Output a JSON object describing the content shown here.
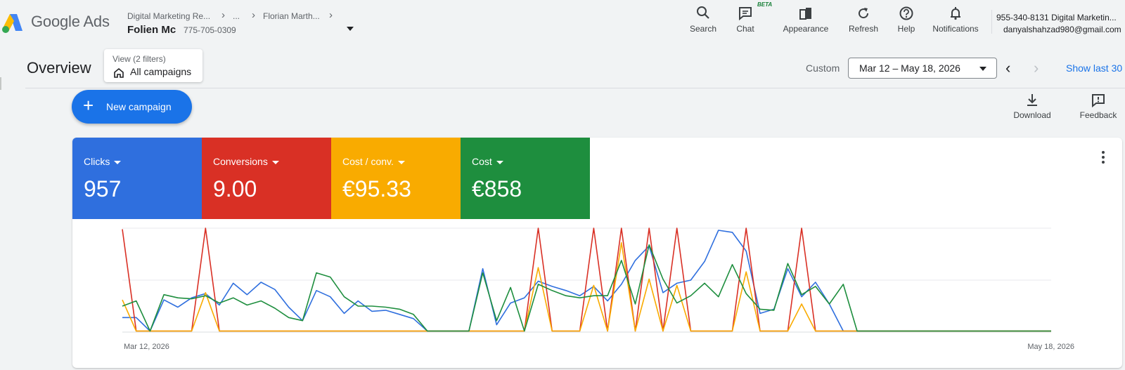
{
  "header": {
    "brand": "Google Ads",
    "breadcrumb": [
      "Digital Marketing Re...",
      "...",
      "Florian Marth..."
    ],
    "account_name": "Folien Mc",
    "account_id": "775-705-0309",
    "tools": [
      {
        "label": "Search",
        "icon": "search-icon"
      },
      {
        "label": "Chat",
        "icon": "chat-icon"
      },
      {
        "label": "Appearance",
        "icon": "appearance-icon"
      },
      {
        "label": "Refresh",
        "icon": "refresh-icon"
      },
      {
        "label": "Help",
        "icon": "help-icon"
      },
      {
        "label": "Notifications",
        "icon": "bell-icon"
      }
    ],
    "chat_badge": "BETA",
    "user_phone": "955-340-8131 Digital Marketin...",
    "user_email": "danyalshahzad980@gmail.com"
  },
  "overview": {
    "title": "Overview",
    "view_label": "View (2 filters)",
    "view_value": "All campaigns",
    "custom_label": "Custom",
    "date_range": "Mar 12 – May 18, 2026",
    "show_last": "Show last 30"
  },
  "actions": {
    "new_campaign": "New campaign",
    "download": "Download",
    "feedback": "Feedback"
  },
  "metrics": [
    {
      "name": "Clicks",
      "value": "957",
      "color": "#2f6fde"
    },
    {
      "name": "Conversions",
      "value": "9.00",
      "color": "#d93025"
    },
    {
      "name": "Cost / conv.",
      "value": "€95.33",
      "color": "#f9ab00"
    },
    {
      "name": "Cost",
      "value": "€858",
      "color": "#1e8e3e"
    }
  ],
  "chart_data": {
    "type": "line",
    "x_start_label": "Mar 12, 2026",
    "x_end_label": "May 18, 2026",
    "ylim": [
      0,
      1
    ],
    "grid": true,
    "series": [
      {
        "name": "Clicks",
        "color": "#2f6fde",
        "values": [
          0.14,
          0.14,
          0.01,
          0.31,
          0.24,
          0.33,
          0.37,
          0.26,
          0.47,
          0.36,
          0.48,
          0.41,
          0.24,
          0.11,
          0.4,
          0.34,
          0.18,
          0.3,
          0.2,
          0.21,
          0.17,
          0.13,
          0.01,
          0.01,
          0.01,
          0.01,
          0.61,
          0.07,
          0.28,
          0.33,
          0.49,
          0.44,
          0.4,
          0.35,
          0.44,
          0.3,
          0.46,
          0.69,
          0.83,
          0.38,
          0.47,
          0.5,
          0.68,
          0.98,
          0.96,
          0.78,
          0.18,
          0.22,
          0.61,
          0.34,
          0.48,
          0.27,
          0.01,
          0.01,
          0.01,
          0.01,
          0.01,
          0.01,
          0.01,
          0.01,
          0.01,
          0.01,
          0.01,
          0.01,
          0.01,
          0.01,
          0.01,
          0.01
        ]
      },
      {
        "name": "Conversions",
        "color": "#d93025",
        "values": [
          0.99,
          0.01,
          0.01,
          0.01,
          0.01,
          0.01,
          1.0,
          0.01,
          0.01,
          0.01,
          0.01,
          0.01,
          0.01,
          0.01,
          0.01,
          0.01,
          0.01,
          0.01,
          0.01,
          0.01,
          0.01,
          0.01,
          0.01,
          0.01,
          0.01,
          0.01,
          0.01,
          0.01,
          0.01,
          0.01,
          1.0,
          0.01,
          0.01,
          0.01,
          1.0,
          0.01,
          1.0,
          0.01,
          1.0,
          0.01,
          1.0,
          0.01,
          0.01,
          0.01,
          0.01,
          1.0,
          0.01,
          0.01,
          0.01,
          1.0,
          0.01,
          0.01,
          0.01,
          0.01,
          0.01,
          0.01,
          0.01,
          0.01,
          0.01,
          0.01,
          0.01,
          0.01,
          0.01,
          0.01,
          0.01,
          0.01,
          0.01,
          0.01
        ]
      },
      {
        "name": "Cost / conv.",
        "color": "#f9ab00",
        "values": [
          0.31,
          0.01,
          0.01,
          0.01,
          0.01,
          0.01,
          0.38,
          0.01,
          0.01,
          0.01,
          0.01,
          0.01,
          0.01,
          0.01,
          0.01,
          0.01,
          0.01,
          0.01,
          0.01,
          0.01,
          0.01,
          0.01,
          0.01,
          0.01,
          0.01,
          0.01,
          0.01,
          0.01,
          0.01,
          0.01,
          0.62,
          0.01,
          0.01,
          0.01,
          0.45,
          0.01,
          0.86,
          0.01,
          0.51,
          0.01,
          0.45,
          0.01,
          0.01,
          0.01,
          0.01,
          0.58,
          0.01,
          0.01,
          0.01,
          0.27,
          0.01,
          0.01,
          0.01,
          0.01,
          0.01,
          0.01,
          0.01,
          0.01,
          0.01,
          0.01,
          0.01,
          0.01,
          0.01,
          0.01,
          0.01,
          0.01,
          0.01,
          0.01
        ]
      },
      {
        "name": "Cost",
        "color": "#1e8e3e",
        "values": [
          0.25,
          0.3,
          0.01,
          0.36,
          0.33,
          0.32,
          0.35,
          0.28,
          0.33,
          0.26,
          0.3,
          0.23,
          0.14,
          0.11,
          0.57,
          0.53,
          0.34,
          0.25,
          0.25,
          0.24,
          0.22,
          0.17,
          0.01,
          0.01,
          0.01,
          0.01,
          0.57,
          0.11,
          0.43,
          0.01,
          0.46,
          0.4,
          0.35,
          0.33,
          0.35,
          0.35,
          0.69,
          0.27,
          0.84,
          0.51,
          0.28,
          0.35,
          0.47,
          0.34,
          0.65,
          0.37,
          0.22,
          0.21,
          0.66,
          0.36,
          0.44,
          0.27,
          0.46,
          0.01,
          0.01,
          0.01,
          0.01,
          0.01,
          0.01,
          0.01,
          0.01,
          0.01,
          0.01,
          0.01,
          0.01,
          0.01,
          0.01,
          0.01
        ]
      }
    ]
  }
}
